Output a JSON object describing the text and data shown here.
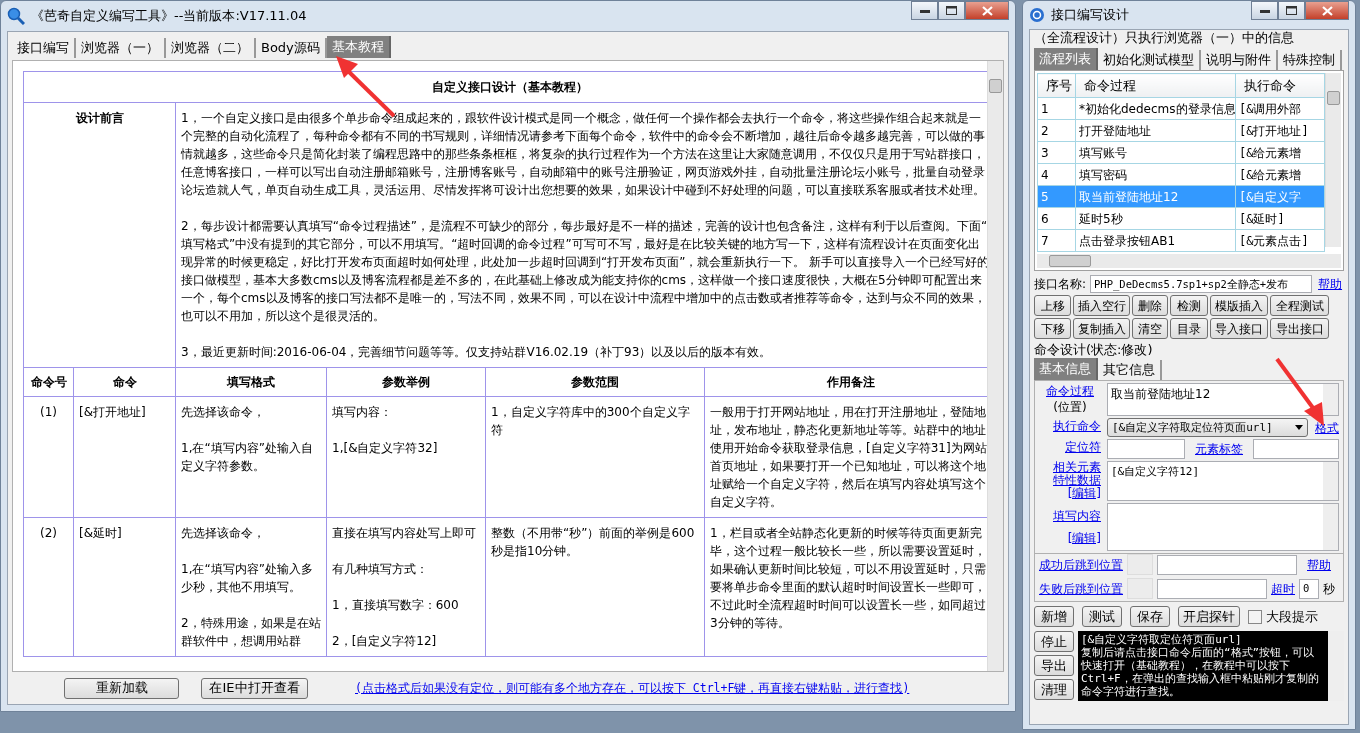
{
  "left_window": {
    "title": "《芭奇自定义编写工具》--当前版本:V17.11.04",
    "tabs": [
      {
        "label": "接口编写",
        "selected": false
      },
      {
        "label": "浏览器（一）",
        "selected": false
      },
      {
        "label": "浏览器（二）",
        "selected": false
      },
      {
        "label": "Body源码",
        "selected": false
      },
      {
        "label": "基本教程",
        "selected": true
      }
    ],
    "doc": {
      "title": "自定义接口设计（基本教程）",
      "preface_label": "设计前言",
      "preface": [
        "1，一个自定义接口是由很多个单步命令组成起来的，跟软件设计模式是同一个概念，做任何一个操作都会去执行一个命令，将这些操作组合起来就是一个完整的自动化流程了，每种命令都有不同的书写规则，详细情况请参考下面每个命令，软件中的命令会不断增加，越往后命令越多越完善，可以做的事情就越多，这些命令只是简化封装了编程思路中的那些条条框框，将复杂的执行过程作为一个方法在这里让大家随意调用，不仅仅只是用于写站群接口，任意博客接口，一样可以写出自动注册邮箱账号，注册博客账号，自动邮箱中的账号注册验证，网页游戏外挂，自动批量注册论坛小账号，批量自动登录论坛造就人气，单页自动生成工具，灵活运用、尽情发挥将可设计出您想要的效果，如果设计中碰到不好处理的问题，可以直接联系客服或者技术处理。",
        "2，每步设计都需要认真填写“命令过程描述”，是流程不可缺少的部分，每步最好是不一样的描述，完善的设计也包含备注，这样有利于以后查阅。下面“填写格式”中没有提到的其它部分，可以不用填写。“超时回调的命令过程”可写可不写，最好是在比较关键的地方写一下，这样有流程设计在页面变化出现异常的时候更稳定，好比打开发布页面超时如何处理，此处加一步超时回调到“打开发布页面”，就会重新执行一下。 新手可以直接导入一个已经写好的接口做模型，基本大多数cms以及博客流程都是差不多的，在此基础上修改成为能支持你的cms，这样做一个接口速度很快，大概在5分钟即可配置出来一个，每个cms以及博客的接口写法都不是唯一的，写法不同，效果不同，可以在设计中流程中增加中的点击数或者推荐等命令，达到与众不同的效果，也可以不用加，所以这个是很灵活的。",
        "3，最近更新时间:2016-06-04，完善细节问题等等。仅支持站群V16.02.19（补丁93）以及以后的版本有效。"
      ],
      "columns": [
        "命令号",
        "命令",
        "填写格式",
        "参数举例",
        "参数范围",
        "作用备注"
      ],
      "rows": [
        {
          "no": "(1)",
          "command": "[&打开地址]",
          "format": [
            "先选择该命令，",
            "1,在“填写内容”处输入自定义字符参数。"
          ],
          "example": [
            "填写内容：",
            "1,[&自定义字符32]"
          ],
          "range": [
            "1，自定义字符库中的300个自定义字符"
          ],
          "note": [
            "一般用于打开网站地址，用在打开注册地址，登陆地址，发布地址，静态化更新地址等等。站群中的地址使用开始命令获取登录信息，[自定义字符31]为网站首页地址，如果要打开一个已知地址，可以将这个地址赋给一个自定义字符，然后在填写内容处填写这个自定义字符。"
          ]
        },
        {
          "no": "(2)",
          "command": "[&延时]",
          "format": [
            "先选择该命令，",
            "1,在“填写内容”处输入多少秒，其他不用填写。",
            "2，特殊用途，如果是在站群软件中，想调用站群"
          ],
          "example": [
            "直接在填写内容处写上即可",
            "有几种填写方式：",
            "1，直接填写数字：600",
            "2，[自定义字符12]"
          ],
          "range": [
            "整数（不用带“秒”）前面的举例是600秒是指10分钟。"
          ],
          "note": [
            "1，栏目或者全站静态化更新的时候等待页面更新完毕，这个过程一般比较长一些，所以需要设置延时，如果确认更新时间比较短，可以不用设置延时，只需要将单步命令里面的默认超时时间设置长一些即可，不过此时全流程超时时间可以设置长一些，如同超过3分钟的等待。"
          ]
        }
      ]
    },
    "buttons": [
      "重新加载",
      "在IE中打开查看"
    ],
    "hint_link": "(点击格式后如果没有定位，则可能有多个地方存在，可以按下 Ctrl+F键，再直接右键粘贴，进行查找)"
  },
  "right_window": {
    "title": "接口编写设计",
    "group_title": "（全流程设计）只执行浏览器（一）中的信息",
    "tabs": [
      {
        "label": "流程列表",
        "selected": true
      },
      {
        "label": "初始化测试模型",
        "selected": false
      },
      {
        "label": "说明与附件",
        "selected": false
      },
      {
        "label": "特殊控制",
        "selected": false
      }
    ],
    "flow_table": {
      "columns": [
        "序号",
        "命令过程",
        "执行命令"
      ],
      "rows": [
        {
          "no": "1",
          "process": "*初始化dedecms的登录信息",
          "command": "[&调用外部",
          "selected": false
        },
        {
          "no": "2",
          "process": "打开登陆地址",
          "command": "[&打开地址]",
          "selected": false
        },
        {
          "no": "3",
          "process": "填写账号",
          "command": "[&给元素增",
          "selected": false
        },
        {
          "no": "4",
          "process": "填写密码",
          "command": "[&给元素增",
          "selected": false
        },
        {
          "no": "5",
          "process": "取当前登陆地址12",
          "command": "[&自定义字",
          "selected": true
        },
        {
          "no": "6",
          "process": "延时5秒",
          "command": "[&延时]",
          "selected": false
        },
        {
          "no": "7",
          "process": "点击登录按钮AB1",
          "command": "[&元素点击]",
          "selected": false
        }
      ]
    },
    "interface_name": {
      "label": "接口名称:",
      "value": "PHP_DeDecms5.7sp1+sp2全静态+发布",
      "help": "帮助"
    },
    "toolbar": [
      [
        "上移",
        "插入空行",
        "删除",
        "检测",
        "模版插入",
        "全程测试"
      ],
      [
        "下移",
        "复制插入",
        "清空",
        "目录",
        "导入接口",
        "导出接口"
      ]
    ],
    "command_design": {
      "title": "命令设计(状态:修改)",
      "tabs": [
        {
          "label": "基本信息",
          "selected": true
        },
        {
          "label": "其它信息",
          "selected": false
        }
      ],
      "process": {
        "link": "命令过程",
        "sub": "(位置)",
        "value": "取当前登陆地址12"
      },
      "exec": {
        "link": "执行命令",
        "value": "[&自定义字符取定位符页面url]",
        "format_link": "格式"
      },
      "locator": {
        "link": "定位符",
        "tag_link": "元素标签"
      },
      "attr": {
        "link": "相关元素特性数据",
        "edit": "[编辑]",
        "value": "[&自定义字符12]"
      },
      "fill": {
        "link": "填写内容",
        "edit": "[编辑]"
      },
      "success": {
        "link": "成功后跳到位置",
        "help": "帮助"
      },
      "fail": {
        "link": "失败后跳到位置",
        "timeout_link": "超时",
        "timeout": "0",
        "unit": "秒"
      }
    },
    "actions": [
      "新增",
      "测试",
      "保存",
      "开启探针"
    ],
    "big_hint": {
      "label": "大段提示",
      "checked": false
    },
    "side_buttons": [
      "停止",
      "导出",
      "清理"
    ],
    "console": [
      "[&自定义字符取定位符页面url]",
      "复制后请点击接口命令后面的“格式”按钮，可以快速打开（基础教程），在教程中可以按下Ctrl+F，在弹出的查找输入框中粘贴刚才复制的命令字符进行查找。"
    ]
  }
}
